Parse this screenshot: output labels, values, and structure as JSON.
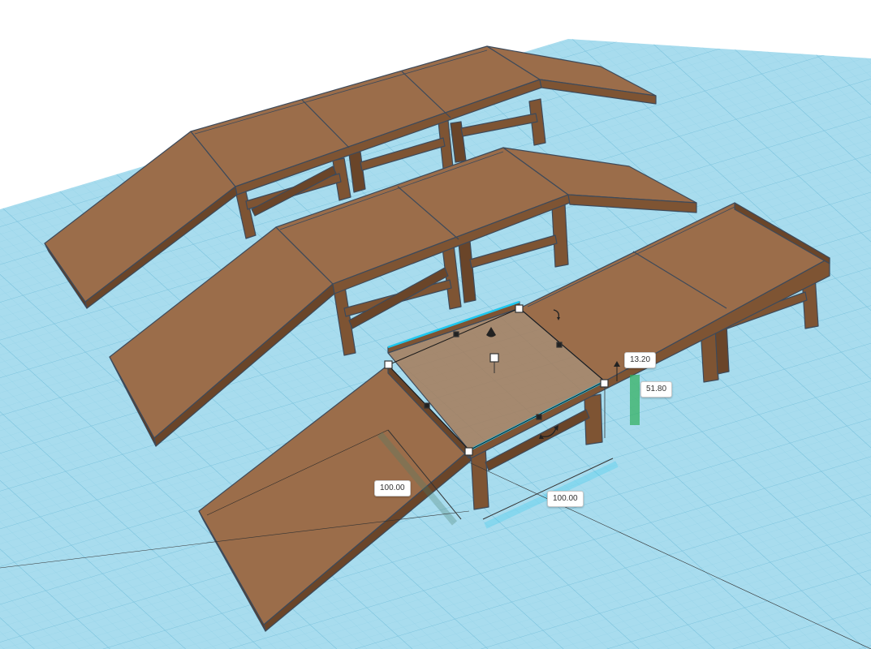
{
  "colors": {
    "workplane": "#a8dcee",
    "grid_line": "#7fc4de",
    "wood_top": "#9b6d4a",
    "wood_side": "#7e5433",
    "wood_dark": "#5e3c22",
    "edge": "#3d4a5a",
    "selection": "#1ec8f0",
    "handle": "#ffffff",
    "height_bar": "#2fae5a"
  },
  "dimensions": {
    "length_left": "100.00",
    "length_bottom": "100.00",
    "elevation": "13.20",
    "height": "51.80"
  },
  "handles": {
    "rotate_top": "rotate-icon",
    "rotate_front": "rotate-icon",
    "lift": "cone-lift-icon"
  }
}
